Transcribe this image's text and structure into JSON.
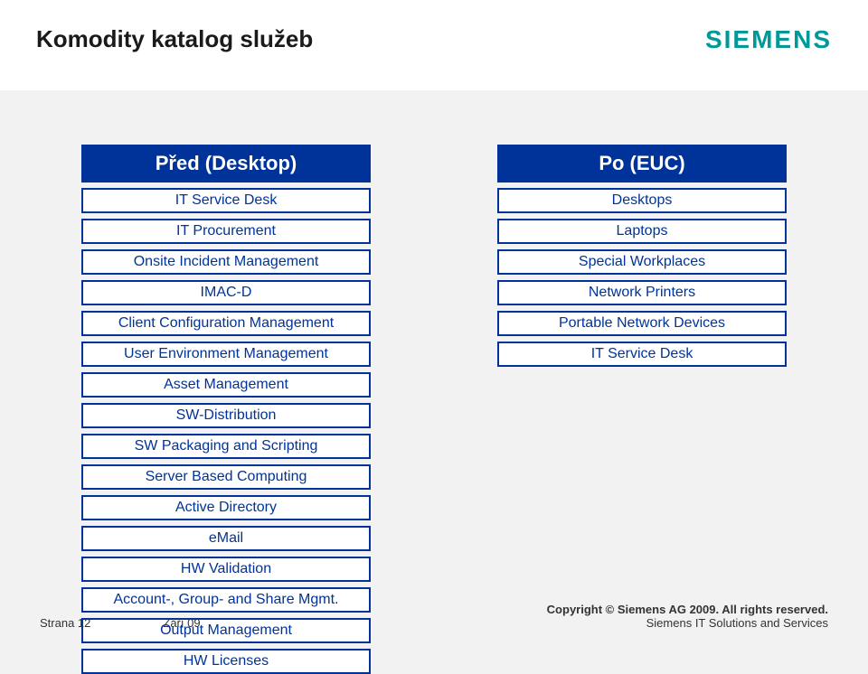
{
  "header": {
    "title": "Komodity katalog služeb",
    "logo": "SIEMENS"
  },
  "left": {
    "header": "Před (Desktop)",
    "items": [
      "IT Service Desk",
      "IT Procurement",
      "Onsite Incident Management",
      "IMAC-D",
      "Client Configuration Management",
      "User Environment Management",
      "Asset Management",
      "SW-Distribution",
      "SW Packaging and Scripting",
      "Server Based Computing",
      "Active Directory",
      "eMail",
      "HW Validation",
      "Account-, Group- and Share Mgmt.",
      "Output Management",
      "HW Licenses"
    ]
  },
  "right": {
    "header": "Po (EUC)",
    "items": [
      "Desktops",
      "Laptops",
      "Special Workplaces",
      "Network Printers",
      "Portable Network Devices",
      "IT Service Desk"
    ]
  },
  "footer": {
    "page": "Strana 12",
    "date": "Září 09",
    "copyright": "Copyright © Siemens AG 2009. All rights reserved.",
    "org": "Siemens IT Solutions and Services"
  }
}
